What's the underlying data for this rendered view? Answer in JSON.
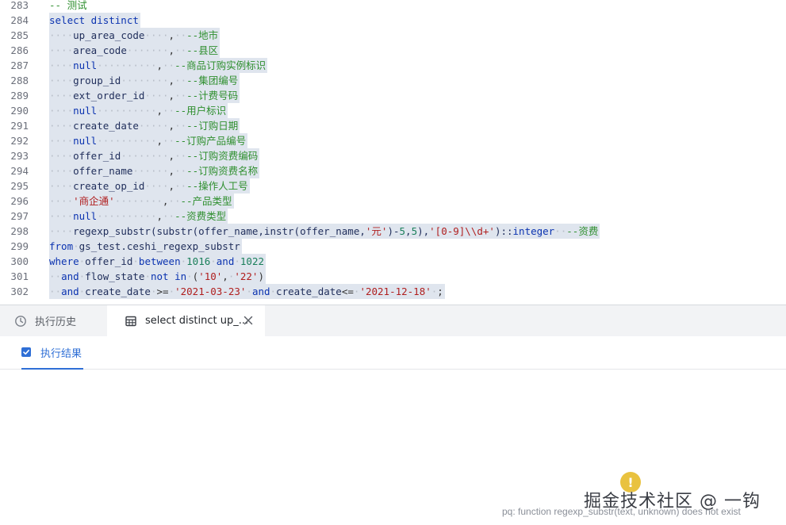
{
  "editor": {
    "lines": [
      {
        "n": "283",
        "sel": false,
        "t": [
          [
            "cm",
            "-- 测试"
          ]
        ]
      },
      {
        "n": "284",
        "sel": true,
        "t": [
          [
            "kw",
            "select distinct"
          ]
        ]
      },
      {
        "n": "285",
        "sel": true,
        "t": [
          [
            "ind",
            "····"
          ],
          [
            "id",
            "up_area_code"
          ],
          [
            "ind",
            "····"
          ],
          [
            "op",
            ","
          ],
          [
            "ind",
            "··"
          ],
          [
            "cm",
            "--地市"
          ]
        ]
      },
      {
        "n": "286",
        "sel": true,
        "t": [
          [
            "ind",
            "····"
          ],
          [
            "id",
            "area_code"
          ],
          [
            "ind",
            "·······"
          ],
          [
            "op",
            ","
          ],
          [
            "ind",
            "··"
          ],
          [
            "cm",
            "--县区"
          ]
        ]
      },
      {
        "n": "287",
        "sel": true,
        "t": [
          [
            "ind",
            "····"
          ],
          [
            "kw",
            "null"
          ],
          [
            "ind",
            "··········"
          ],
          [
            "op",
            ","
          ],
          [
            "ind",
            "··"
          ],
          [
            "cm",
            "--商品订购实例标识"
          ]
        ]
      },
      {
        "n": "288",
        "sel": true,
        "t": [
          [
            "ind",
            "····"
          ],
          [
            "id",
            "group_id"
          ],
          [
            "ind",
            "········"
          ],
          [
            "op",
            ","
          ],
          [
            "ind",
            "··"
          ],
          [
            "cm",
            "--集团编号"
          ]
        ]
      },
      {
        "n": "289",
        "sel": true,
        "t": [
          [
            "ind",
            "····"
          ],
          [
            "id",
            "ext_order_id"
          ],
          [
            "ind",
            "····"
          ],
          [
            "op",
            ","
          ],
          [
            "ind",
            "··"
          ],
          [
            "cm",
            "--计费号码"
          ]
        ]
      },
      {
        "n": "290",
        "sel": true,
        "t": [
          [
            "ind",
            "····"
          ],
          [
            "kw",
            "null"
          ],
          [
            "ind",
            "··········"
          ],
          [
            "op",
            ","
          ],
          [
            "ind",
            "··"
          ],
          [
            "cm",
            "--用户标识"
          ]
        ]
      },
      {
        "n": "291",
        "sel": true,
        "t": [
          [
            "ind",
            "····"
          ],
          [
            "id",
            "create_date"
          ],
          [
            "ind",
            "·····"
          ],
          [
            "op",
            ","
          ],
          [
            "ind",
            "··"
          ],
          [
            "cm",
            "--订购日期"
          ]
        ]
      },
      {
        "n": "292",
        "sel": true,
        "t": [
          [
            "ind",
            "····"
          ],
          [
            "kw",
            "null"
          ],
          [
            "ind",
            "··········"
          ],
          [
            "op",
            ","
          ],
          [
            "ind",
            "··"
          ],
          [
            "cm",
            "--订购产品编号"
          ]
        ]
      },
      {
        "n": "293",
        "sel": true,
        "t": [
          [
            "ind",
            "····"
          ],
          [
            "id",
            "offer_id"
          ],
          [
            "ind",
            "········"
          ],
          [
            "op",
            ","
          ],
          [
            "ind",
            "··"
          ],
          [
            "cm",
            "--订购资费编码"
          ]
        ]
      },
      {
        "n": "294",
        "sel": true,
        "t": [
          [
            "ind",
            "····"
          ],
          [
            "id",
            "offer_name"
          ],
          [
            "ind",
            "······"
          ],
          [
            "op",
            ","
          ],
          [
            "ind",
            "··"
          ],
          [
            "cm",
            "--订购资费名称"
          ]
        ]
      },
      {
        "n": "295",
        "sel": true,
        "t": [
          [
            "ind",
            "····"
          ],
          [
            "id",
            "create_op_id"
          ],
          [
            "ind",
            "····"
          ],
          [
            "op",
            ","
          ],
          [
            "ind",
            "··"
          ],
          [
            "cm",
            "--操作人工号"
          ]
        ]
      },
      {
        "n": "296",
        "sel": true,
        "t": [
          [
            "ind",
            "····"
          ],
          [
            "str",
            "'商企通'"
          ],
          [
            "ind",
            "········"
          ],
          [
            "op",
            ","
          ],
          [
            "ind",
            "··"
          ],
          [
            "cm",
            "--产品类型"
          ]
        ]
      },
      {
        "n": "297",
        "sel": true,
        "t": [
          [
            "ind",
            "····"
          ],
          [
            "kw",
            "null"
          ],
          [
            "ind",
            "··········"
          ],
          [
            "op",
            ","
          ],
          [
            "ind",
            "··"
          ],
          [
            "cm",
            "--资费类型"
          ]
        ]
      },
      {
        "n": "298",
        "sel": true,
        "t": [
          [
            "ind",
            "····"
          ],
          [
            "id",
            "regexp_substr(substr(offer_name,instr(offer_name,"
          ],
          [
            "str",
            "'元'"
          ],
          [
            "id",
            ")-"
          ],
          [
            "num",
            "5"
          ],
          [
            "id",
            ","
          ],
          [
            "num",
            "5"
          ],
          [
            "id",
            "),"
          ],
          [
            "str",
            "'[0-9]\\\\d+'"
          ],
          [
            "id",
            ")::"
          ],
          [
            "kw",
            "integer"
          ],
          [
            "ind",
            "··"
          ],
          [
            "cm",
            "--资费"
          ]
        ]
      },
      {
        "n": "299",
        "sel": true,
        "t": [
          [
            "kw",
            "from"
          ],
          [
            "ind",
            "·"
          ],
          [
            "id",
            "gs_test.ceshi_regexp_substr"
          ]
        ]
      },
      {
        "n": "300",
        "sel": true,
        "t": [
          [
            "kw",
            "where"
          ],
          [
            "ind",
            "·"
          ],
          [
            "id",
            "offer_id"
          ],
          [
            "ind",
            "·"
          ],
          [
            "kw",
            "between"
          ],
          [
            "ind",
            "·"
          ],
          [
            "num",
            "1016"
          ],
          [
            "ind",
            "·"
          ],
          [
            "kw",
            "and"
          ],
          [
            "ind",
            "·"
          ],
          [
            "num",
            "1022"
          ]
        ]
      },
      {
        "n": "301",
        "sel": true,
        "t": [
          [
            "ind",
            "··"
          ],
          [
            "kw",
            "and"
          ],
          [
            "ind",
            "·"
          ],
          [
            "id",
            "flow_state"
          ],
          [
            "ind",
            "·"
          ],
          [
            "kw",
            "not in"
          ],
          [
            "ind",
            "·"
          ],
          [
            "op",
            "("
          ],
          [
            "str",
            "'10'"
          ],
          [
            "op",
            ","
          ],
          [
            "ind",
            "·"
          ],
          [
            "str",
            "'22'"
          ],
          [
            "op",
            ")"
          ]
        ]
      },
      {
        "n": "302",
        "sel": true,
        "t": [
          [
            "ind",
            "··"
          ],
          [
            "kw",
            "and"
          ],
          [
            "ind",
            "·"
          ],
          [
            "id",
            "create_date"
          ],
          [
            "ind",
            "·"
          ],
          [
            "op",
            ">="
          ],
          [
            "ind",
            "·"
          ],
          [
            "str",
            "'2021-03-23'"
          ],
          [
            "ind",
            "·"
          ],
          [
            "kw",
            "and"
          ],
          [
            "ind",
            "·"
          ],
          [
            "id",
            "create_date"
          ],
          [
            "op",
            "<="
          ],
          [
            "ind",
            "·"
          ],
          [
            "str",
            "'2021-12-18'"
          ],
          [
            "ind",
            "·"
          ],
          [
            "op",
            ";"
          ]
        ]
      }
    ]
  },
  "panel": {
    "tabs": [
      {
        "label": "执行历史",
        "icon": "history-icon"
      },
      {
        "label": "select distinct up_...",
        "icon": "table-icon"
      }
    ],
    "subtab_label": "执行结果",
    "watermark": "掘金技术社区 @ 一钩",
    "error_message": "pq: function regexp_substr(text, unknown) does not exist"
  },
  "colors": {
    "accent": "#2f6fd6",
    "keyword": "#0b33b0",
    "comment": "#2f8f2f",
    "string": "#b01f1f",
    "number": "#1a7f5a",
    "selection": "#dfe5ee",
    "warning": "#e9c23f"
  }
}
